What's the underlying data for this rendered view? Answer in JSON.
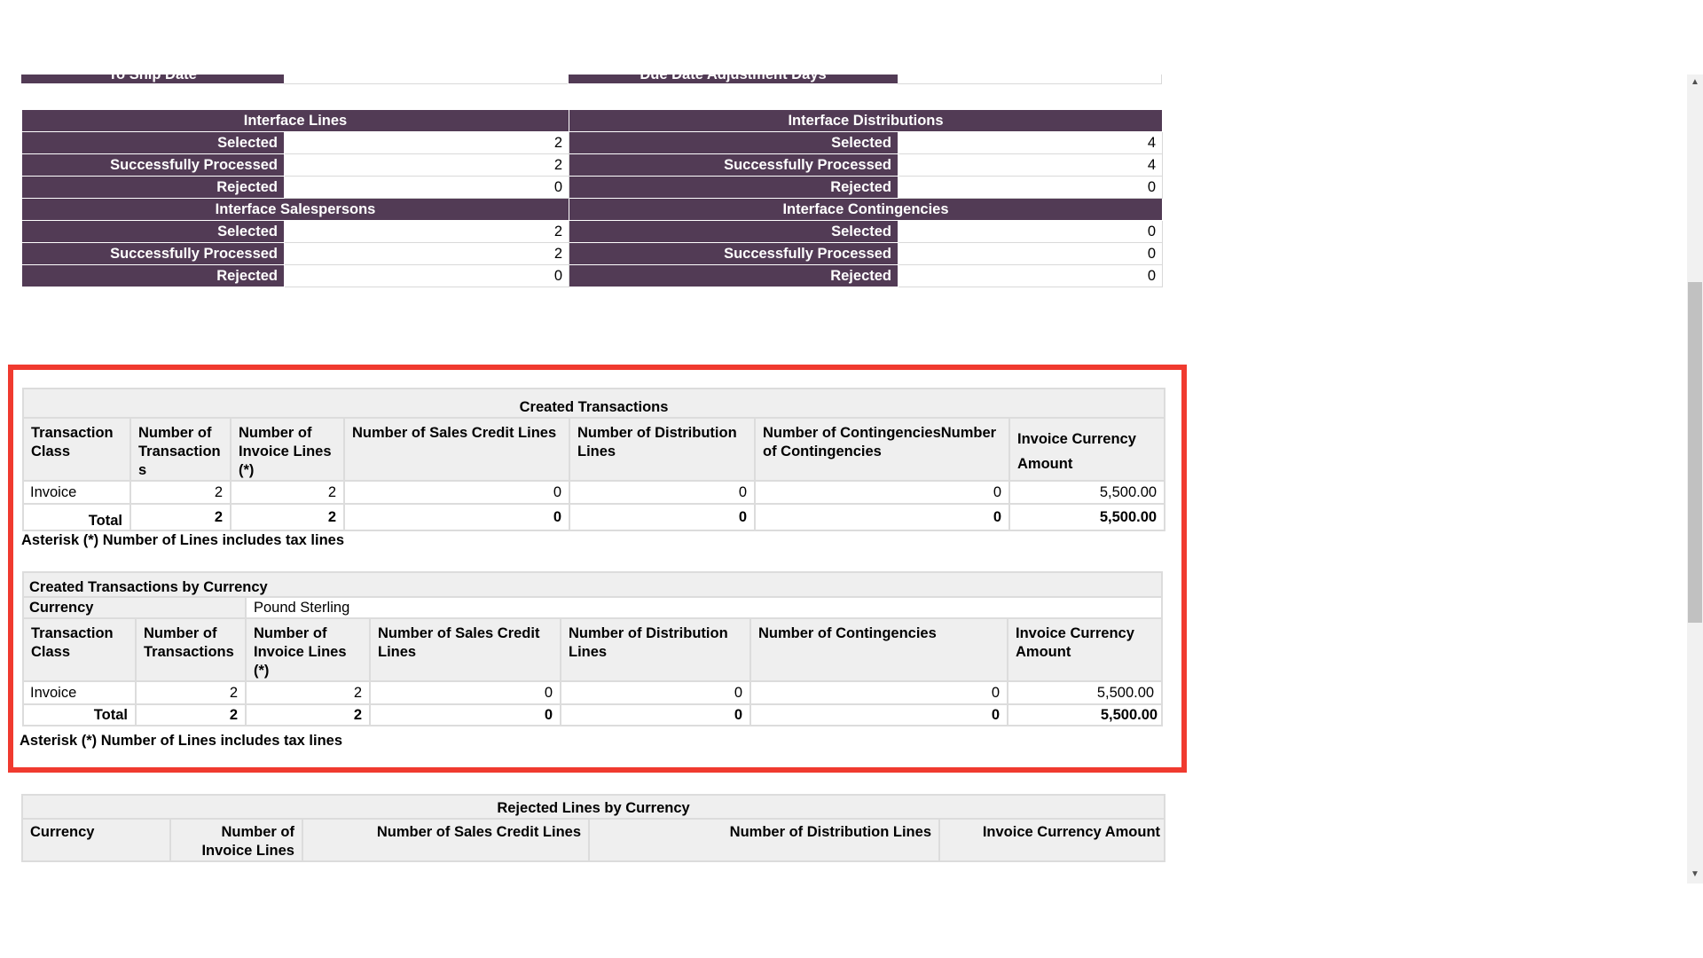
{
  "top_partial": {
    "left_label": "To Ship Date",
    "right_label": "Due Date Adjustment Days"
  },
  "interface_summary": {
    "lines": {
      "title": "Interface Lines",
      "selected": "2",
      "processed": "2",
      "rejected": "0"
    },
    "distributions": {
      "title": "Interface Distributions",
      "selected": "4",
      "processed": "4",
      "rejected": "0"
    },
    "salespersons": {
      "title": "Interface Salespersons",
      "selected": "2",
      "processed": "2",
      "rejected": "0"
    },
    "contingencies": {
      "title": "Interface Contingencies",
      "selected": "0",
      "processed": "0",
      "rejected": "0"
    },
    "labels": {
      "selected": "Selected",
      "processed": "Successfully Processed",
      "rejected": "Rejected"
    }
  },
  "created_transactions": {
    "title": "Created Transactions",
    "headers": [
      "Transaction Class",
      "Number of Transaction s",
      "Number of Invoice Lines (*)",
      "Number of Sales Credit Lines",
      "Number of Distribution Lines",
      "Number of ContingenciesNumber of Contingencies",
      "Invoice Currency Amount"
    ],
    "row": [
      "Invoice",
      "2",
      "2",
      "0",
      "0",
      "0",
      "5,500.00"
    ],
    "total": [
      "Total",
      "2",
      "2",
      "0",
      "0",
      "0",
      "5,500.00"
    ],
    "note": "Asterisk (*) Number of Lines includes tax lines"
  },
  "by_currency": {
    "title": "Created Transactions by Currency",
    "currency_label": "Currency",
    "currency_value": "Pound Sterling",
    "headers": [
      "Transaction Class",
      "Number of Transactions",
      "Number of Invoice Lines (*)",
      "Number of Sales Credit Lines",
      "Number of Distribution Lines",
      "Number of Contingencies",
      "Invoice Currency Amount"
    ],
    "row": [
      "Invoice",
      "2",
      "2",
      "0",
      "0",
      "0",
      "5,500.00"
    ],
    "total": [
      "Total",
      "2",
      "2",
      "0",
      "0",
      "0",
      "5,500.00"
    ],
    "note": "Asterisk (*) Number of Lines includes tax lines"
  },
  "rejected": {
    "title": "Rejected Lines by Currency",
    "headers": [
      "Currency",
      "Number of Invoice Lines",
      "Number of Sales Credit Lines",
      "Number of Distribution Lines",
      "Invoice Currency Amount"
    ]
  },
  "colors": {
    "header_purple": "#523b55",
    "highlight_red": "#f03a2f",
    "grey_header": "#efefef"
  },
  "icons": {
    "scroll_up": "scroll-up-arrow-icon",
    "scroll_down": "scroll-down-arrow-icon"
  }
}
